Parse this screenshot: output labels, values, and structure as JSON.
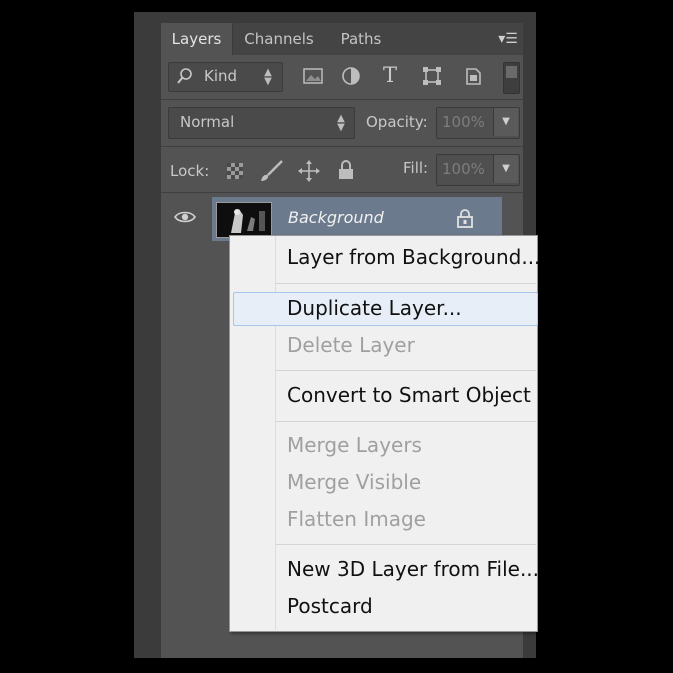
{
  "tabs": [
    {
      "label": "Layers",
      "active": true
    },
    {
      "label": "Channels",
      "active": false
    },
    {
      "label": "Paths",
      "active": false
    }
  ],
  "filter": {
    "label": "Kind",
    "icon": "search-icon"
  },
  "filter_icons": [
    "image-filter-icon",
    "adjustment-filter-icon",
    "type-filter-icon",
    "shape-filter-icon",
    "smart-object-filter-icon",
    "filter-toggle-switch"
  ],
  "blend_mode": {
    "value": "Normal"
  },
  "opacity": {
    "label": "Opacity:",
    "value": "100%"
  },
  "lock": {
    "label": "Lock:",
    "icons": [
      "lock-transparent-icon",
      "lock-image-icon",
      "lock-position-icon",
      "lock-all-icon"
    ]
  },
  "fill": {
    "label": "Fill:",
    "value": "100%"
  },
  "layer": {
    "name": "Background",
    "visible": true,
    "locked": true
  },
  "context_menu": {
    "items": [
      {
        "label": "Layer from Background...",
        "enabled": true
      },
      {
        "label": "Duplicate Layer...",
        "enabled": true,
        "hovered": true
      },
      {
        "label": "Delete Layer",
        "enabled": false
      },
      {
        "label": "Convert to Smart Object",
        "enabled": true
      },
      {
        "label": "Merge Layers",
        "enabled": false
      },
      {
        "label": "Merge Visible",
        "enabled": false
      },
      {
        "label": "Flatten Image",
        "enabled": false
      },
      {
        "label": "New 3D Layer from File...",
        "enabled": true
      },
      {
        "label": "Postcard",
        "enabled": true
      }
    ]
  },
  "colors": {
    "panel": "#535353",
    "selected_layer": "#6b7a8d",
    "menu_bg": "#f0f0f0",
    "menu_hover": "#e7eef8"
  }
}
